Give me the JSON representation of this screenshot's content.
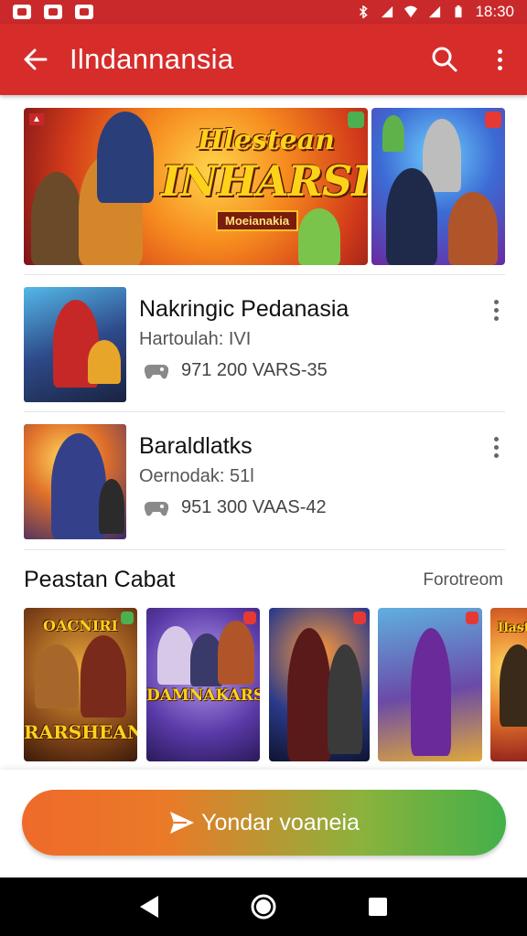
{
  "status_bar": {
    "time": "18:30"
  },
  "app_bar": {
    "title": "Ilndannansia"
  },
  "banner": {
    "title_line1": "Hlestean",
    "title_line2": "INHARSIN",
    "subtitle": "Moeianakia"
  },
  "list": [
    {
      "title": "Nakringic Pedanasia",
      "subtitle": "Hartoulah: IVI",
      "meta": "971 200  VARS-35"
    },
    {
      "title": "Baraldlatks",
      "subtitle": "Oernodak: 51l",
      "meta": "951 300  VAAS-42"
    }
  ],
  "section": {
    "title": "Peastan Cabat",
    "link": "Forotreom"
  },
  "cards": [
    {
      "top_text": "OACNIRI",
      "bottom_text": "RARSHEAN"
    },
    {
      "top_text": "",
      "bottom_text": "DAMNAKARS"
    },
    {
      "top_text": "",
      "bottom_text": ""
    },
    {
      "top_text": "",
      "bottom_text": ""
    },
    {
      "top_text": "Ilaste",
      "bottom_text": ""
    }
  ],
  "cta": {
    "label": "Yondar voaneia"
  },
  "colors": {
    "primary": "#d62d2b",
    "cta_start": "#ef6a2a",
    "cta_end": "#43b04a"
  }
}
